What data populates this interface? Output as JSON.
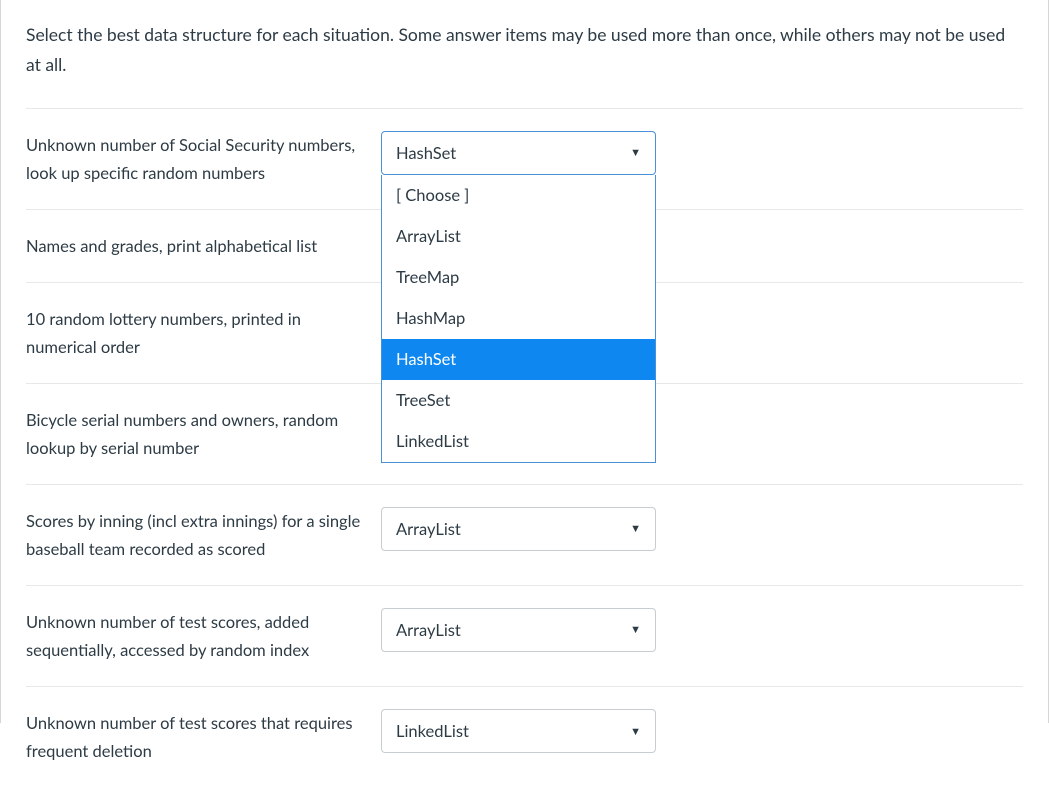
{
  "instructions": "Select the best data structure for each situation. Some answer items may be used more than once, while others may not be used at all.",
  "dropdown_options": {
    "choose": "[ Choose ]",
    "arraylist": "ArrayList",
    "treemap": "TreeMap",
    "hashmap": "HashMap",
    "hashset": "HashSet",
    "treeset": "TreeSet",
    "linkedlist": "LinkedList"
  },
  "questions": [
    {
      "prompt": "Unknown number of Social Security numbers, look up specific random numbers",
      "selected": "HashSet",
      "open": true,
      "highlight": "HashSet"
    },
    {
      "prompt": "Names and grades, print alphabetical list",
      "selected": "",
      "open": false
    },
    {
      "prompt": "10 random lottery numbers, printed in numerical order",
      "selected": "",
      "open": false
    },
    {
      "prompt": "Bicycle serial numbers and owners, random lookup by serial number",
      "selected": "",
      "open": false
    },
    {
      "prompt": "Scores by inning (incl extra innings) for a single baseball team recorded as scored",
      "selected": "ArrayList",
      "open": false
    },
    {
      "prompt": "Unknown number of test scores, added sequentially, accessed by random index",
      "selected": "ArrayList",
      "open": false
    },
    {
      "prompt": "Unknown number of test scores that requires frequent deletion",
      "selected": "LinkedList",
      "open": false
    }
  ]
}
